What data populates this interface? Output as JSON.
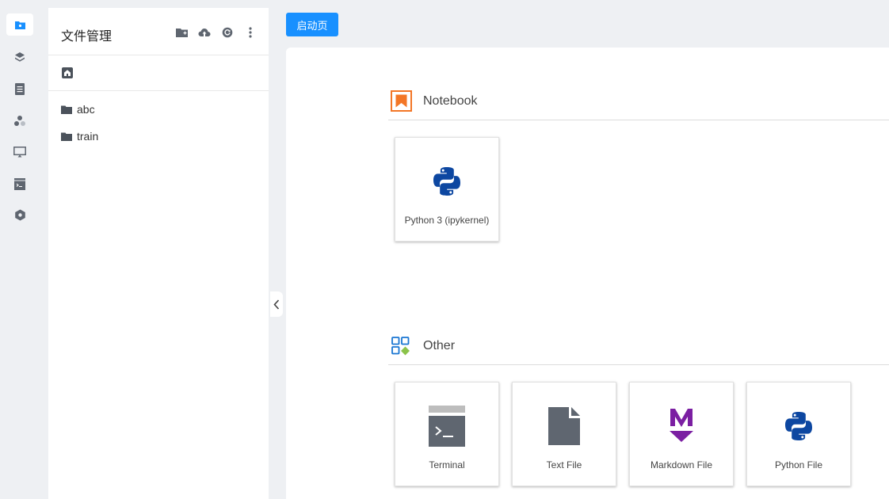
{
  "rail": {
    "items": [
      {
        "name": "files",
        "icon": "folder-icon",
        "active": true
      },
      {
        "name": "layers",
        "icon": "layers-icon"
      },
      {
        "name": "document",
        "icon": "document-icon"
      },
      {
        "name": "extensions",
        "icon": "shapes-icon"
      },
      {
        "name": "display",
        "icon": "monitor-icon"
      },
      {
        "name": "terminal",
        "icon": "terminal-icon"
      },
      {
        "name": "settings",
        "icon": "hexagon-icon"
      }
    ]
  },
  "file_panel": {
    "title": "文件管理",
    "actions": [
      "new-folder-icon",
      "upload-icon",
      "refresh-icon",
      "more-icon"
    ],
    "items": [
      {
        "name": "abc",
        "type": "folder"
      },
      {
        "name": "train",
        "type": "folder"
      }
    ]
  },
  "tab": {
    "label": "启动页"
  },
  "launcher": {
    "sections": [
      {
        "label": "Notebook",
        "icon": "notebook-icon",
        "cards": [
          {
            "label": "Python 3 (ipykernel)",
            "icon": "python-icon"
          }
        ]
      },
      {
        "label": "Other",
        "icon": "other-icon",
        "cards": [
          {
            "label": "Terminal",
            "icon": "terminal-icon"
          },
          {
            "label": "Text File",
            "icon": "text-file-icon"
          },
          {
            "label": "Markdown File",
            "icon": "markdown-icon"
          },
          {
            "label": "Python File",
            "icon": "python-icon"
          }
        ]
      }
    ]
  },
  "colors": {
    "accent": "#1890ff",
    "notebook_orange": "#f37626",
    "python_blue": "#0d47a1",
    "markdown_purple": "#7b1fa2",
    "terminal_gray": "#616161"
  }
}
